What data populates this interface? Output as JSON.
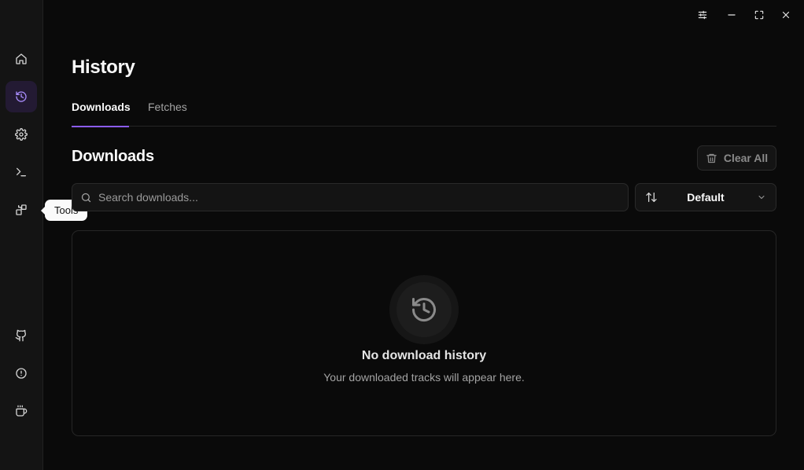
{
  "sidebar": {
    "items": [
      {
        "name": "home",
        "icon": "home-icon"
      },
      {
        "name": "history",
        "icon": "history-icon",
        "active": true
      },
      {
        "name": "settings",
        "icon": "gear-icon"
      },
      {
        "name": "terminal",
        "icon": "terminal-icon"
      },
      {
        "name": "tools",
        "icon": "tools-icon"
      },
      {
        "name": "github",
        "icon": "github-icon"
      },
      {
        "name": "about",
        "icon": "info-icon"
      },
      {
        "name": "support",
        "icon": "coffee-icon"
      }
    ],
    "tooltip": "Tools"
  },
  "window": {
    "controls": [
      "settings-sliders",
      "minimize",
      "maximize",
      "close"
    ]
  },
  "main": {
    "title": "History",
    "tabs": [
      {
        "label": "Downloads",
        "active": true
      },
      {
        "label": "Fetches",
        "active": false
      }
    ],
    "section_title": "Downloads",
    "clear_all_label": "Clear All",
    "search": {
      "placeholder": "Search downloads...",
      "value": ""
    },
    "sort": {
      "label": "Default"
    },
    "empty": {
      "title": "No download history",
      "subtitle": "Your downloaded tracks will appear here."
    }
  },
  "colors": {
    "accent": "#8b5cf6",
    "background": "#0a0a0a",
    "sidebar": "#141414"
  }
}
